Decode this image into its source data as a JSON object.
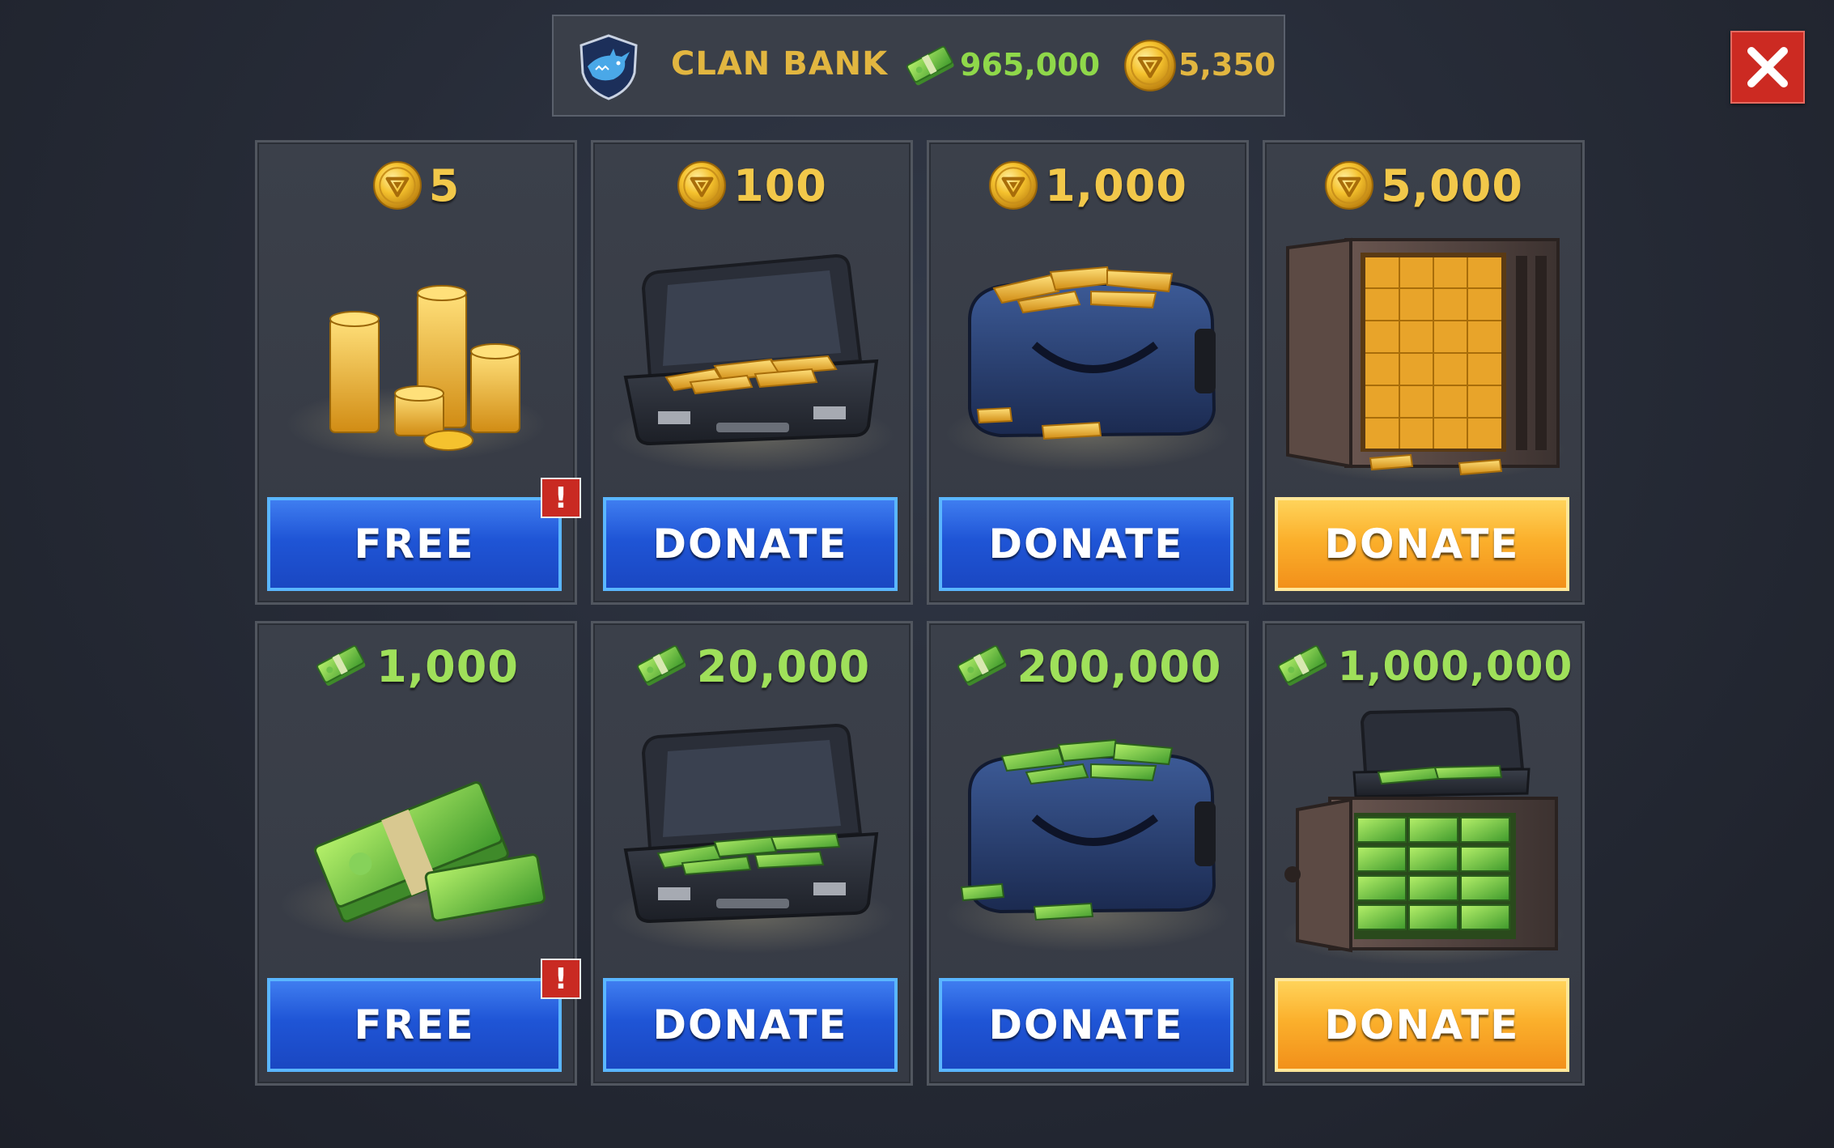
{
  "header": {
    "title": "CLAN BANK",
    "cash_balance": "965,000",
    "coin_balance": "5,350",
    "emblem_icon": "shark-emblem-icon"
  },
  "close_button": {
    "icon": "close-icon"
  },
  "colors": {
    "gold_text": "#e2b640",
    "green_text": "#8fd84a",
    "button_blue": "#1f55d6",
    "button_orange": "#fbb02c",
    "close_red": "#cc2a22"
  },
  "coin_donations": [
    {
      "price": "5",
      "currency": "coin",
      "art": "coin-stacks",
      "button": "FREE",
      "button_style": "blue",
      "alert": "!"
    },
    {
      "price": "100",
      "currency": "coin",
      "art": "briefcase-gold",
      "button": "DONATE",
      "button_style": "blue"
    },
    {
      "price": "1,000",
      "currency": "coin",
      "art": "duffel-bag-gold",
      "button": "DONATE",
      "button_style": "blue"
    },
    {
      "price": "5,000",
      "currency": "coin",
      "art": "vault-gold",
      "button": "DONATE",
      "button_style": "orange"
    }
  ],
  "cash_donations": [
    {
      "price": "1,000",
      "currency": "cash",
      "art": "cash-stack",
      "button": "FREE",
      "button_style": "blue",
      "alert": "!"
    },
    {
      "price": "20,000",
      "currency": "cash",
      "art": "briefcase-cash",
      "button": "DONATE",
      "button_style": "blue"
    },
    {
      "price": "200,000",
      "currency": "cash",
      "art": "duffel-bag-cash",
      "button": "DONATE",
      "button_style": "blue"
    },
    {
      "price": "1,000,000",
      "currency": "cash",
      "art": "vault-cash",
      "button": "DONATE",
      "button_style": "orange"
    }
  ]
}
